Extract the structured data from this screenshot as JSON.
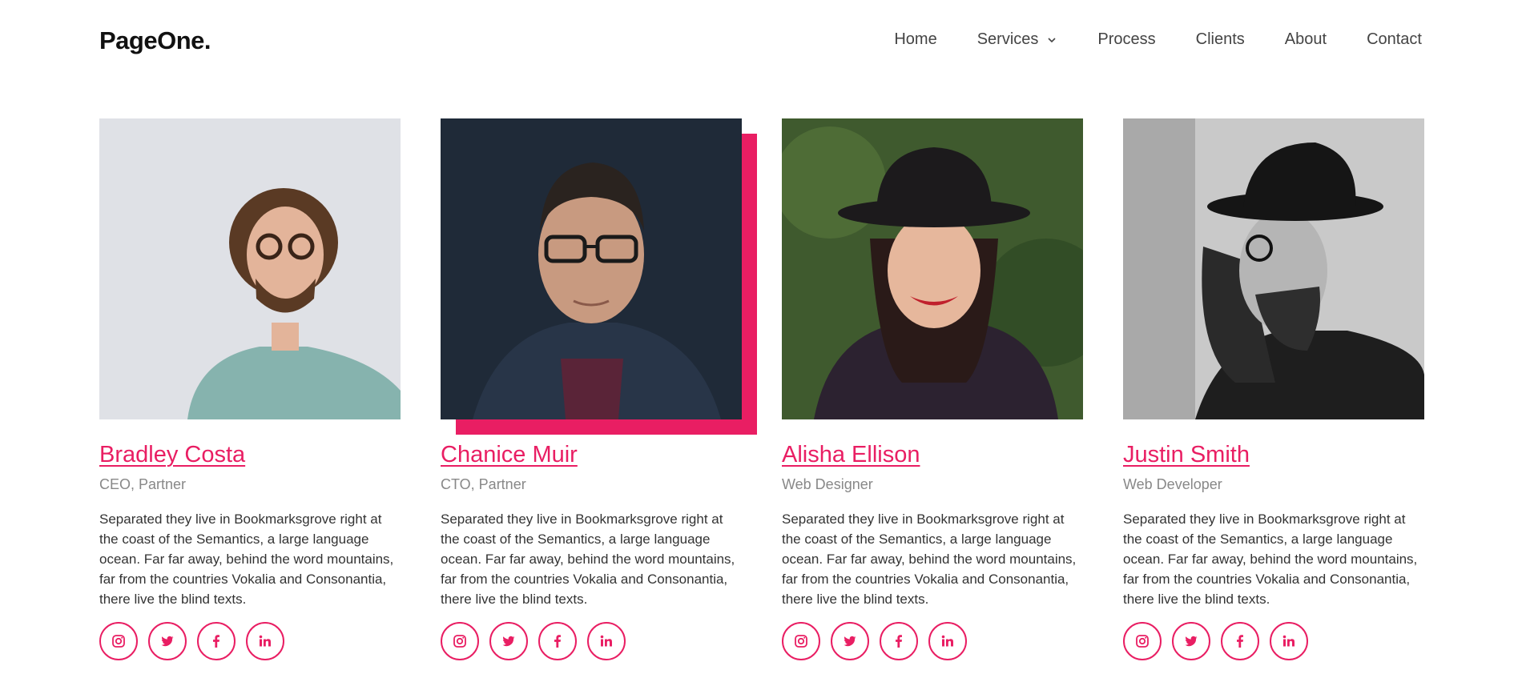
{
  "brand": {
    "name": "PageOne."
  },
  "nav": {
    "items": [
      {
        "label": "Home"
      },
      {
        "label": "Services",
        "has_dropdown": true
      },
      {
        "label": "Process"
      },
      {
        "label": "Clients"
      },
      {
        "label": "About"
      },
      {
        "label": "Contact"
      }
    ]
  },
  "theme": {
    "accent": "#e91e63"
  },
  "team": [
    {
      "name": "Bradley Costa",
      "role": "CEO, Partner",
      "bio": "Separated they live in Bookmarksgrove right at the coast of the Semantics, a large language ocean. Far far away, behind the word mountains, far from the countries Vokalia and Consonantia, there live the blind texts.",
      "socials": [
        "instagram-icon",
        "twitter-icon",
        "facebook-icon",
        "linkedin-icon"
      ]
    },
    {
      "name": "Chanice Muir",
      "role": "CTO, Partner",
      "bio": "Separated they live in Bookmarksgrove right at the coast of the Semantics, a large language ocean. Far far away, behind the word mountains, far from the countries Vokalia and Consonantia, there live the blind texts.",
      "socials": [
        "instagram-icon",
        "twitter-icon",
        "facebook-icon",
        "linkedin-icon"
      ],
      "highlighted": true
    },
    {
      "name": "Alisha Ellison",
      "role": "Web Designer",
      "bio": "Separated they live in Bookmarksgrove right at the coast of the Semantics, a large language ocean. Far far away, behind the word mountains, far from the countries Vokalia and Consonantia, there live the blind texts.",
      "socials": [
        "instagram-icon",
        "twitter-icon",
        "facebook-icon",
        "linkedin-icon"
      ]
    },
    {
      "name": "Justin Smith",
      "role": "Web Developer",
      "bio": "Separated they live in Bookmarksgrove right at the coast of the Semantics, a large language ocean. Far far away, behind the word mountains, far from the countries Vokalia and Consonantia, there live the blind texts.",
      "socials": [
        "instagram-icon",
        "twitter-icon",
        "facebook-icon",
        "linkedin-icon"
      ]
    }
  ]
}
